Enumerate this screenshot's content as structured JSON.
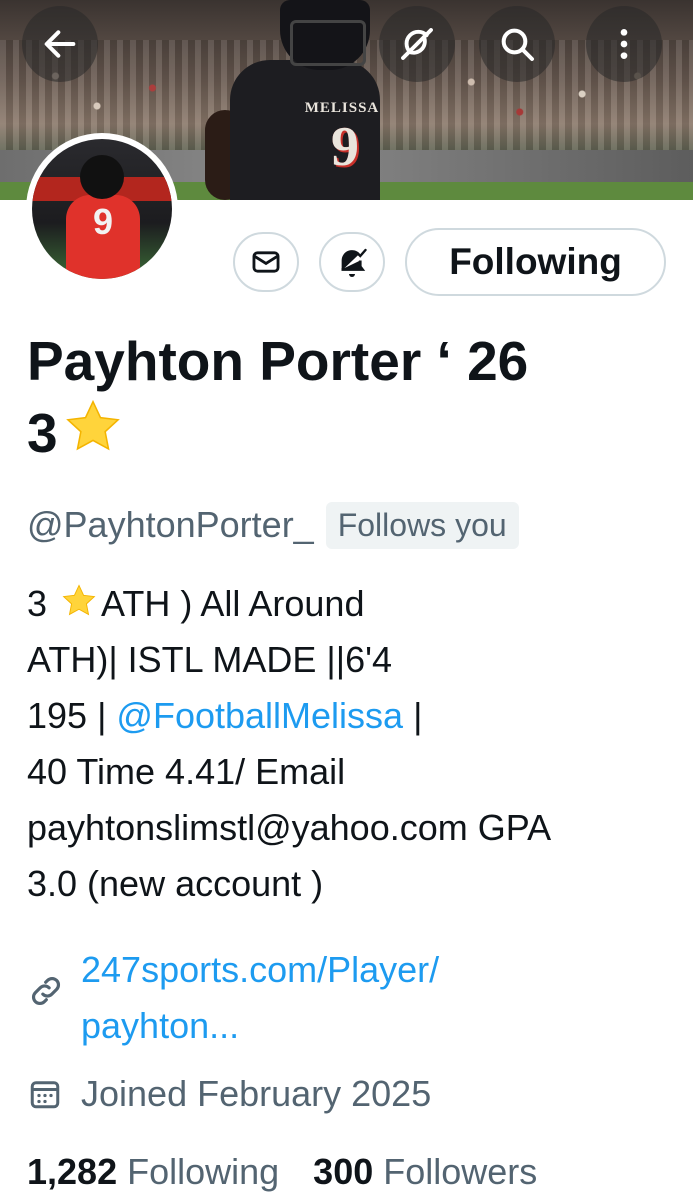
{
  "header": {
    "back_icon": "arrow-left-icon",
    "grok_icon": "grok-icon",
    "search_icon": "search-icon",
    "more_icon": "more-vertical-icon",
    "banner_jersey_word": "MELISSA",
    "banner_jersey_number": "9"
  },
  "avatar": {
    "jersey_number": "9"
  },
  "actions": {
    "message_icon": "envelope-icon",
    "notifications_icon": "bell-check-icon",
    "following_label": "Following"
  },
  "profile": {
    "name_line1": "Payhton Porter ‘ 26",
    "name_line2": "3",
    "name_emoji": "star-emoji",
    "handle": "@PayhtonPorter_",
    "follows_you": "Follows you"
  },
  "bio": {
    "line1_before_star": "3 ",
    "line1_after_star": "ATH ) All Around",
    "line2": "ATH)| ISTL MADE ||6'4",
    "line3_before": "195 | ",
    "line3_mention": "@FootballMelissa",
    "line3_after": " |",
    "line4": "40 Time 4.41/ Email",
    "line5": "payhtonslimstl@yahoo.com GPA",
    "line6": "3.0 (new account )"
  },
  "meta": {
    "link_line1": "247sports.com/Player/",
    "link_line2": "payhton...",
    "joined": "Joined February 2025"
  },
  "stats": {
    "following_count": "1,282",
    "following_label": "Following",
    "followers_count": "300",
    "followers_label": "Followers"
  },
  "colors": {
    "link_blue": "#1d9bf0",
    "secondary_text": "#536471",
    "border": "#cfd9de",
    "star_yellow": "#ffd43b"
  }
}
